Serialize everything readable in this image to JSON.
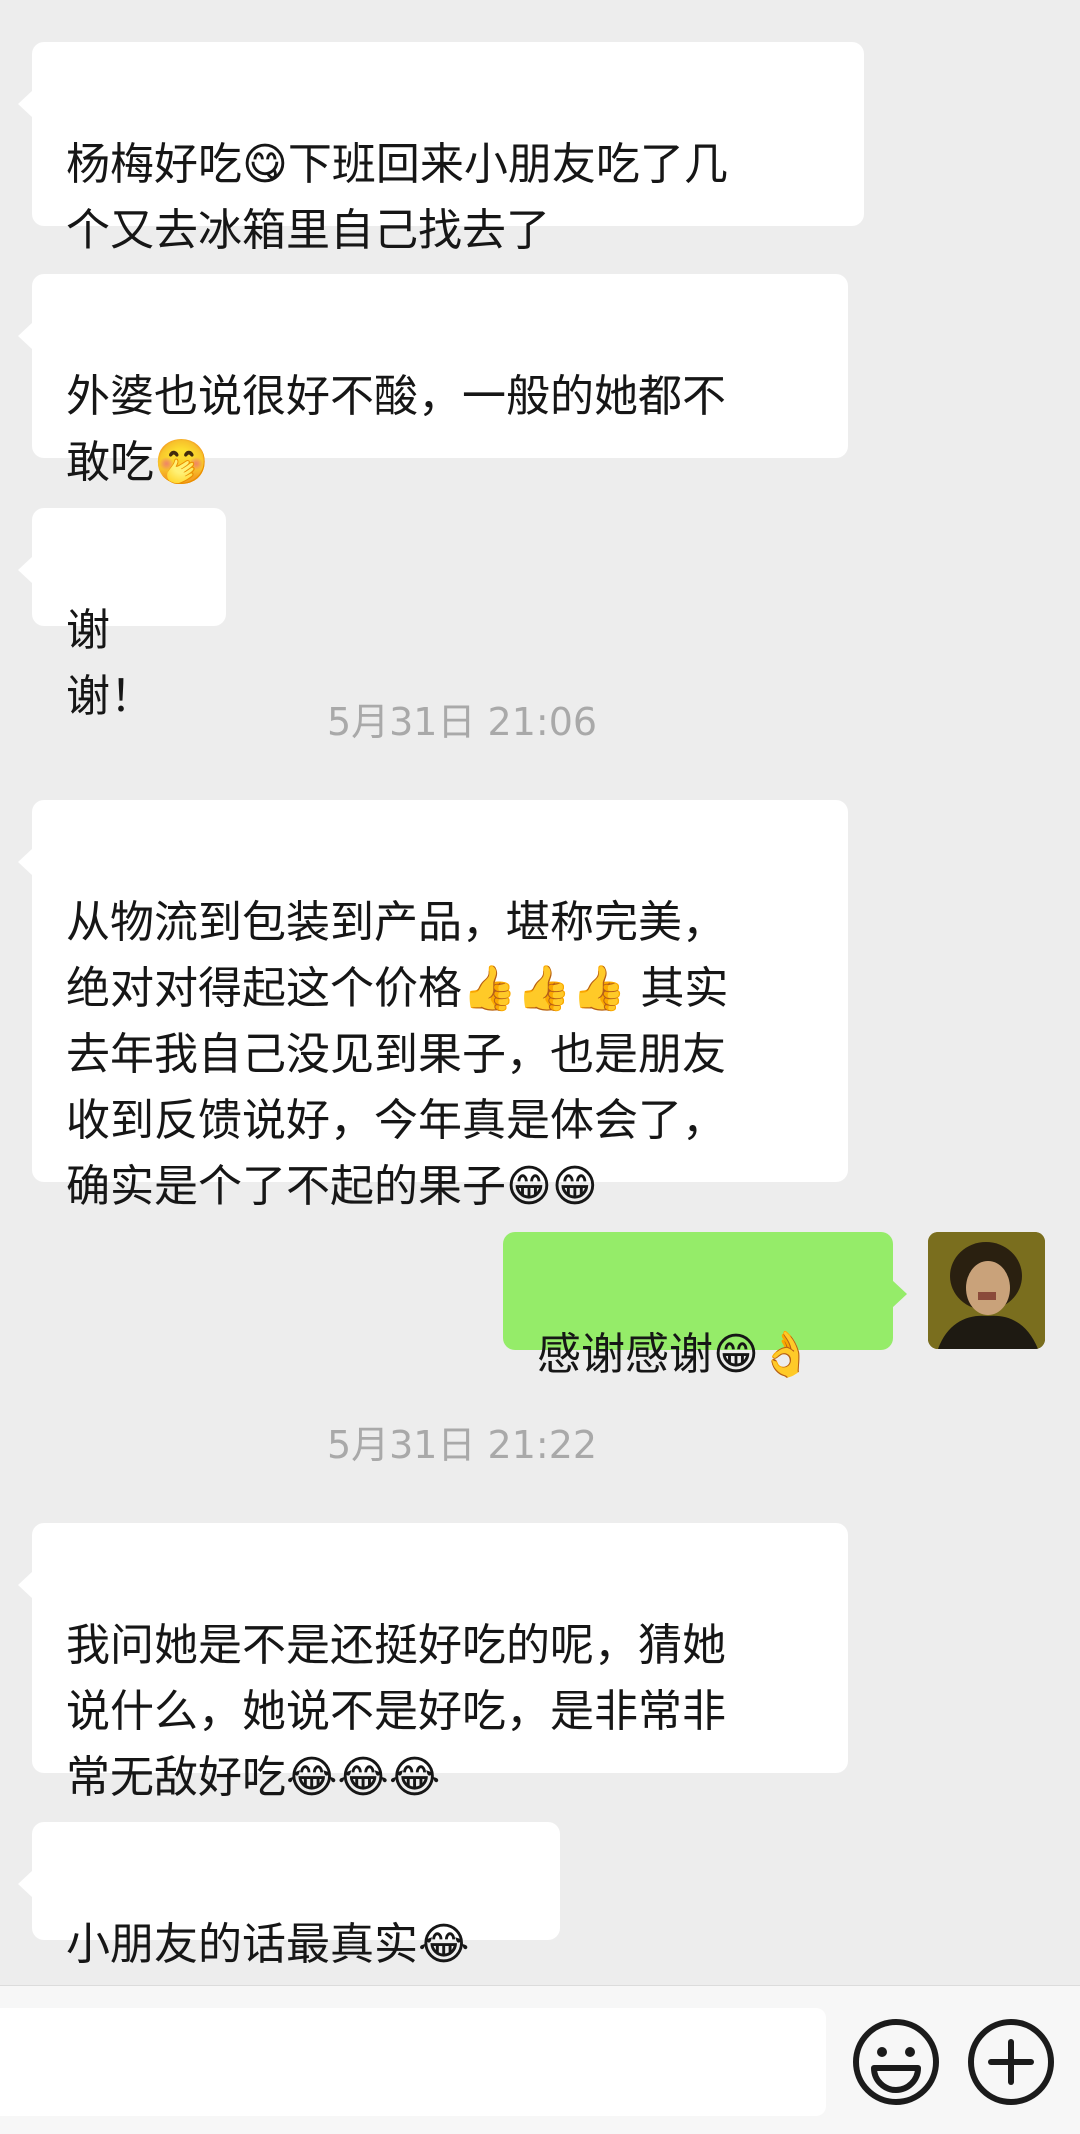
{
  "messages": [
    {
      "sender": "other",
      "text": "杨梅好吃😋下班回来小朋友吃了几\n个又去冰箱里自己找去了"
    },
    {
      "sender": "other",
      "text": "外婆也说很好不酸，一般的她都不\n敢吃🤭"
    },
    {
      "sender": "other",
      "text": "谢谢！"
    },
    {
      "sender": "other",
      "text": "从物流到包装到产品，堪称完美，\n绝对对得起这个价格👍👍👍 其实\n去年我自己没见到果子，也是朋友\n收到反馈说好，今年真是体会了，\n确实是个了不起的果子😁😁"
    },
    {
      "sender": "self",
      "text": "感谢感谢😁👌"
    },
    {
      "sender": "other",
      "text": "我问她是不是还挺好吃的呢，猜她\n说什么，她说不是好吃，是非常非\n常无敌好吃😂😂😂"
    },
    {
      "sender": "other",
      "text": "小朋友的话最真实😂"
    }
  ],
  "timestamps": [
    "5月31日 21:06",
    "5月31日 21:22"
  ],
  "input_bar": {
    "icons": [
      "emoji-icon",
      "plus-icon"
    ]
  },
  "colors": {
    "background": "#ededed",
    "incoming_bubble": "#ffffff",
    "outgoing_bubble": "#95ec69",
    "timestamp_text": "#a9a9a9"
  }
}
